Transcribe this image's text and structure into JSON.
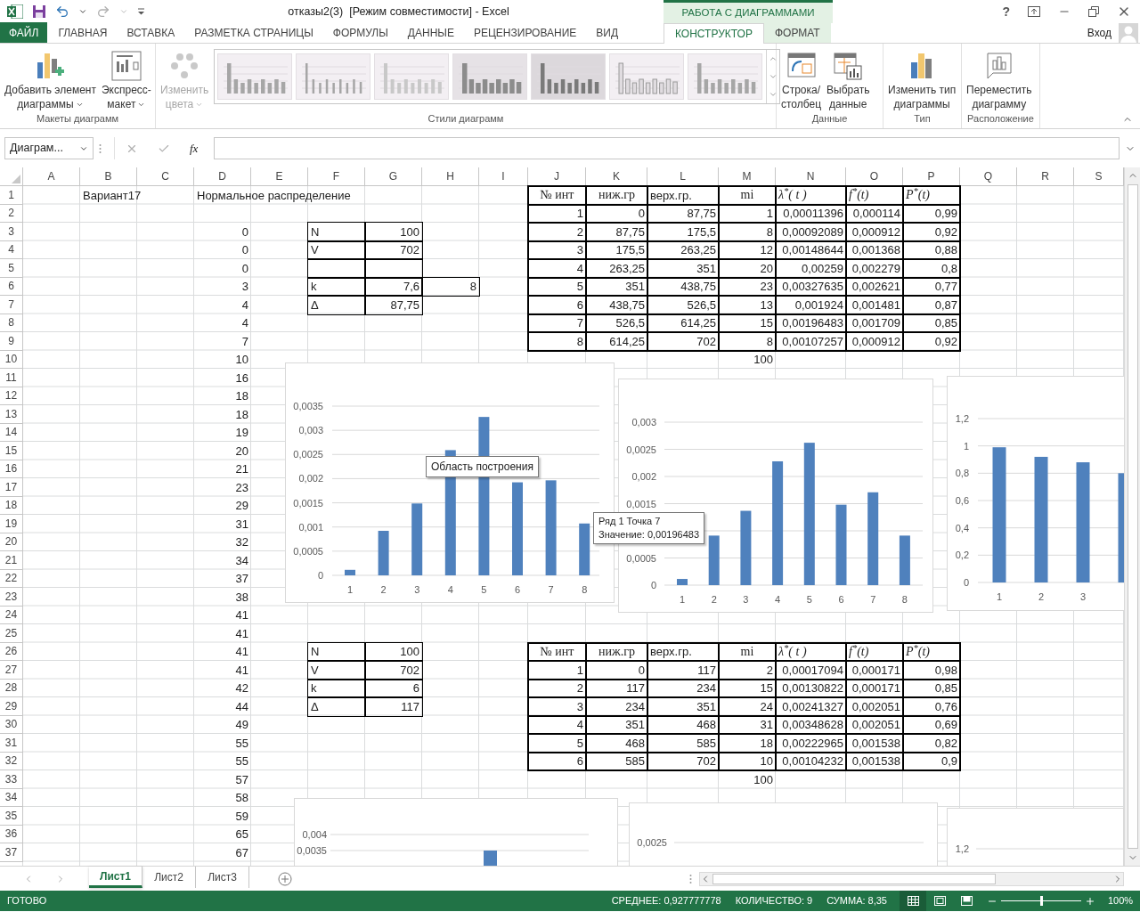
{
  "window": {
    "title": "отказы2(3)  [Режим совместимости] - Excel",
    "context_group": "РАБОТА С ДИАГРАММАМИ",
    "help": "?",
    "sign_in": "Вход"
  },
  "tabs": [
    {
      "label": "ФАЙЛ",
      "kind": "file",
      "selected": false
    },
    {
      "label": "ГЛАВНАЯ",
      "kind": "normal",
      "selected": false
    },
    {
      "label": "ВСТАВКА",
      "kind": "normal",
      "selected": false
    },
    {
      "label": "РАЗМЕТКА СТРАНИЦЫ",
      "kind": "normal",
      "selected": false
    },
    {
      "label": "ФОРМУЛЫ",
      "kind": "normal",
      "selected": false
    },
    {
      "label": "ДАННЫЕ",
      "kind": "normal",
      "selected": false
    },
    {
      "label": "РЕЦЕНЗИРОВАНИЕ",
      "kind": "normal",
      "selected": false
    },
    {
      "label": "ВИД",
      "kind": "normal",
      "selected": false
    },
    {
      "label": "КОНСТРУКТОР",
      "kind": "contextual",
      "selected": true
    },
    {
      "label": "ФОРМАТ",
      "kind": "contextual",
      "selected": false
    }
  ],
  "ribbon": {
    "groups": [
      {
        "label": "Макеты диаграмм",
        "buttons": [
          {
            "lines": [
              "Добавить элемент",
              "диаграммы"
            ],
            "kind": "add-element",
            "dropdown": true,
            "disabled": false
          },
          {
            "lines": [
              "Экспресс-",
              "макет"
            ],
            "kind": "quick-layout",
            "dropdown": true,
            "disabled": false
          }
        ]
      },
      {
        "label": "Стили диаграмм",
        "buttons": [
          {
            "lines": [
              "Изменить",
              "цвета"
            ],
            "kind": "colors",
            "dropdown": true,
            "disabled": true
          }
        ],
        "styles": [
          {
            "kind": "plain"
          },
          {
            "kind": "thin"
          },
          {
            "kind": "dotted"
          },
          {
            "kind": "shaded"
          },
          {
            "kind": "dark"
          },
          {
            "kind": "outlined"
          },
          {
            "kind": "plain"
          }
        ]
      },
      {
        "label": "Данные",
        "buttons": [
          {
            "lines": [
              "Строка/",
              "столбец"
            ],
            "kind": "switch",
            "dropdown": false,
            "disabled": false
          },
          {
            "lines": [
              "Выбрать",
              "данные"
            ],
            "kind": "select-data",
            "dropdown": false,
            "disabled": false
          }
        ]
      },
      {
        "label": "Тип",
        "buttons": [
          {
            "lines": [
              "Изменить тип",
              "диаграммы"
            ],
            "kind": "change-type",
            "dropdown": false,
            "disabled": false
          }
        ]
      },
      {
        "label": "Расположение",
        "buttons": [
          {
            "lines": [
              "Переместить",
              "диаграмму"
            ],
            "kind": "move",
            "dropdown": false,
            "disabled": false
          }
        ]
      }
    ]
  },
  "formula_bar": {
    "name_box": "Диаграм...",
    "function_label": "fx"
  },
  "sheet": {
    "columns": [
      "A",
      "B",
      "C",
      "D",
      "E",
      "F",
      "G",
      "H",
      "I",
      "J",
      "K",
      "L",
      "M",
      "N",
      "O",
      "P",
      "Q",
      "R",
      "S"
    ],
    "row_numbers": [
      "1",
      "2",
      "3",
      "4",
      "5",
      "6",
      "7",
      "8",
      "9",
      "10",
      "11",
      "12",
      "13",
      "14",
      "15",
      "16",
      "17",
      "18",
      "19",
      "20",
      "21",
      "22",
      "23",
      "24",
      "25",
      "26",
      "27",
      "28",
      "29",
      "30",
      "31",
      "32",
      "33",
      "34",
      "35",
      "36",
      "37"
    ],
    "title_cells": [
      "Вариант17",
      "Нормальное распределение"
    ],
    "sample_values": [
      "0",
      "0",
      "0",
      "3",
      "4",
      "4",
      "7",
      "10",
      "16",
      "18",
      "18",
      "19",
      "20",
      "21",
      "23",
      "29",
      "31",
      "32",
      "34",
      "37",
      "38",
      "41",
      "41",
      "41",
      "41",
      "42",
      "44",
      "49",
      "55",
      "55",
      "57",
      "58",
      "59",
      "65",
      "67"
    ],
    "parameter_tables": [
      {
        "rows": [
          {
            "label": "N",
            "value": "100"
          },
          {
            "label": "V",
            "value": "702"
          },
          {},
          {
            "label": "k",
            "value": "7,6",
            "extra": "8"
          },
          {
            "label": "Δ",
            "value": "87,75"
          }
        ]
      },
      {
        "rows": [
          {
            "label": "N",
            "value": "100"
          },
          {
            "label": "V",
            "value": "702"
          },
          {
            "label": "k",
            "value": "6"
          },
          {
            "label": "Δ",
            "value": "117"
          }
        ]
      }
    ],
    "interval_tables": [
      {
        "columns": [
          {
            "label": "№ инт",
            "kind": "header"
          },
          {
            "label": "ниж.гр",
            "kind": "header"
          },
          {
            "label": "верх.гр.",
            "kind": "label"
          },
          {
            "label": "mi",
            "kind": "header"
          },
          {
            "label": "λ$^{*}$( t )",
            "kind": "formula"
          },
          {
            "label": "f$^{*}$(t)",
            "kind": "formula"
          },
          {
            "label": "P$^{*}$(t)",
            "kind": "formula"
          }
        ],
        "rows": [
          [
            "1",
            "0",
            "87,75",
            "1",
            "0,00011396",
            "0,000114",
            "0,99"
          ],
          [
            "2",
            "87,75",
            "175,5",
            "8",
            "0,00092089",
            "0,000912",
            "0,92"
          ],
          [
            "3",
            "175,5",
            "263,25",
            "12",
            "0,00148644",
            "0,001368",
            "0,88"
          ],
          [
            "4",
            "263,25",
            "351",
            "20",
            "0,00259",
            "0,002279",
            "0,8"
          ],
          [
            "5",
            "351",
            "438,75",
            "23",
            "0,00327635",
            "0,002621",
            "0,77"
          ],
          [
            "6",
            "438,75",
            "526,5",
            "13",
            "0,001924",
            "0,001481",
            "0,87"
          ],
          [
            "7",
            "526,5",
            "614,25",
            "15",
            "0,00196483",
            "0,001709",
            "0,85"
          ],
          [
            "8",
            "614,25",
            "702",
            "8",
            "0,00107257",
            "0,000912",
            "0,92"
          ]
        ],
        "total": "100"
      },
      {
        "columns": [
          {
            "label": "№ инт",
            "kind": "header"
          },
          {
            "label": "ниж.гр",
            "kind": "header"
          },
          {
            "label": "верх.гр.",
            "kind": "label"
          },
          {
            "label": "mi",
            "kind": "header"
          },
          {
            "label": "λ$^{*}$( t )",
            "kind": "formula"
          },
          {
            "label": "f$^{*}$(t)",
            "kind": "formula"
          },
          {
            "label": "P$^{*}$(t)",
            "kind": "formula"
          }
        ],
        "rows": [
          [
            "1",
            "0",
            "117",
            "2",
            "0,00017094",
            "0,000171",
            "0,98"
          ],
          [
            "2",
            "117",
            "234",
            "15",
            "0,00130822",
            "0,000171",
            "0,85"
          ],
          [
            "3",
            "234",
            "351",
            "24",
            "0,00241327",
            "0,002051",
            "0,76"
          ],
          [
            "4",
            "351",
            "468",
            "31",
            "0,00348628",
            "0,002051",
            "0,69"
          ],
          [
            "5",
            "468",
            "585",
            "18",
            "0,00222965",
            "0,001538",
            "0,82"
          ],
          [
            "6",
            "585",
            "702",
            "10",
            "0,00104232",
            "0,001538",
            "0,9"
          ]
        ],
        "total": "100"
      }
    ]
  },
  "charts": [
    {
      "chart_data": {
        "type": "bar",
        "grid": true,
        "categories": [
          "1",
          "2",
          "3",
          "4",
          "5",
          "6",
          "7",
          "8"
        ],
        "values": [
          0.00011396,
          0.00092089,
          0.00148644,
          0.00259,
          0.00327635,
          0.001924,
          0.00196483,
          0.00107257
        ],
        "ylim": [
          0,
          0.0035
        ],
        "yticks": [
          {
            "value": 0,
            "label": "0"
          },
          {
            "value": 0.0005,
            "label": "0,0005"
          },
          {
            "value": 0.001,
            "label": "0,001"
          },
          {
            "value": 0.0015,
            "label": "0,0015"
          },
          {
            "value": 0.002,
            "label": "0,002"
          },
          {
            "value": 0.0025,
            "label": "0,0025"
          },
          {
            "value": 0.003,
            "label": "0,003"
          },
          {
            "value": 0.0035,
            "label": "0,0035"
          }
        ]
      }
    },
    {
      "chart_data": {
        "type": "bar",
        "grid": true,
        "categories": [
          "1",
          "2",
          "3",
          "4",
          "5",
          "6",
          "7",
          "8"
        ],
        "values": [
          0.000114,
          0.000912,
          0.001368,
          0.002279,
          0.002621,
          0.001481,
          0.001709,
          0.000912
        ],
        "ylim": [
          0,
          0.003
        ],
        "yticks": [
          {
            "value": 0,
            "label": "0"
          },
          {
            "value": 0.0005,
            "label": "0,0005"
          },
          {
            "value": 0.0015,
            "label": "0,0015"
          },
          {
            "value": 0.002,
            "label": "0,002"
          },
          {
            "value": 0.0025,
            "label": "0,0025"
          },
          {
            "value": 0.003,
            "label": "0,003"
          }
        ]
      }
    },
    {
      "chart_data": {
        "type": "bar",
        "grid": true,
        "categories": [
          "1",
          "2",
          "3",
          null
        ],
        "values": [
          0.99,
          0.92,
          0.88,
          0.8
        ],
        "ylim": [
          0,
          1.2
        ],
        "yticks": [
          {
            "value": 0,
            "label": "0"
          },
          {
            "value": 0.2,
            "label": "0,2"
          },
          {
            "value": 0.4,
            "label": "0,4"
          },
          {
            "value": 0.6,
            "label": "0,6"
          },
          {
            "value": 0.8,
            "label": "0,8"
          },
          {
            "value": 1,
            "label": "1"
          },
          {
            "value": 1.2,
            "label": "1,2"
          }
        ]
      }
    }
  ],
  "lower_charts": [
    {
      "tick_labels": [
        "0,004",
        "0,0035"
      ]
    },
    {
      "tick_labels": [
        "0,0025"
      ]
    },
    {
      "tick_labels": [
        "1,2"
      ]
    }
  ],
  "plot_area_tooltip": "Область построения",
  "point_tooltip": {
    "title": "Ряд 1 Точка 7",
    "value": "Значение: 0,00196483"
  },
  "sheet_tabs": [
    {
      "label": "Лист1",
      "selected": true
    },
    {
      "label": "Лист2",
      "selected": false
    },
    {
      "label": "Лист3",
      "selected": false
    }
  ],
  "status_bar": {
    "state": "ГОТОВО",
    "stats": [
      "СРЕДНЕЕ: 0,927777778",
      "КОЛИЧЕСТВО: 9",
      "СУММА: 8,35"
    ],
    "views": [
      {
        "kind": "normal",
        "selected": true
      },
      {
        "kind": "page-layout",
        "selected": false
      },
      {
        "kind": "page-break",
        "selected": false
      }
    ],
    "zoom": {
      "level": 0.5,
      "label": "100%"
    }
  }
}
